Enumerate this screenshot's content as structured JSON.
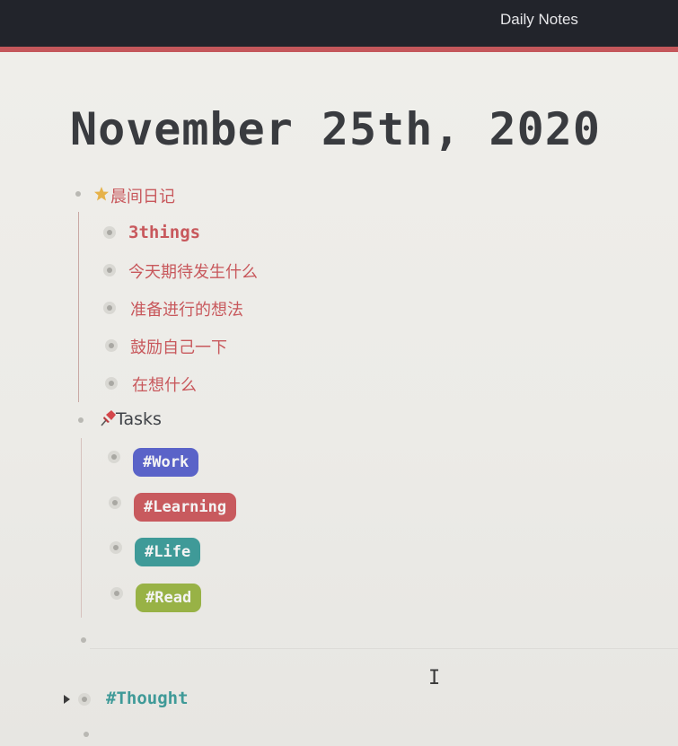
{
  "app": {
    "title": "Daily Notes"
  },
  "page": {
    "title": "November 25th, 2020"
  },
  "morning": {
    "icon": "star-icon",
    "label": "晨间日记",
    "items": [
      "3things",
      "今天期待发生什么",
      "准备进行的想法",
      "鼓励自己一下",
      "在想什么"
    ]
  },
  "tasks": {
    "icon": "pushpin-icon",
    "label": "Tasks",
    "tags": [
      {
        "label": "#Work",
        "color": "#5a63c8"
      },
      {
        "label": "#Learning",
        "color": "#c85a5e"
      },
      {
        "label": "#Life",
        "color": "#3f9a98"
      },
      {
        "label": "#Read",
        "color": "#98b246"
      }
    ]
  },
  "thought": {
    "label": "#Thought",
    "color": "#3f9a98"
  },
  "colors": {
    "header_bg": "#22242b",
    "accent": "#c4575b",
    "text": "#393b3f"
  }
}
